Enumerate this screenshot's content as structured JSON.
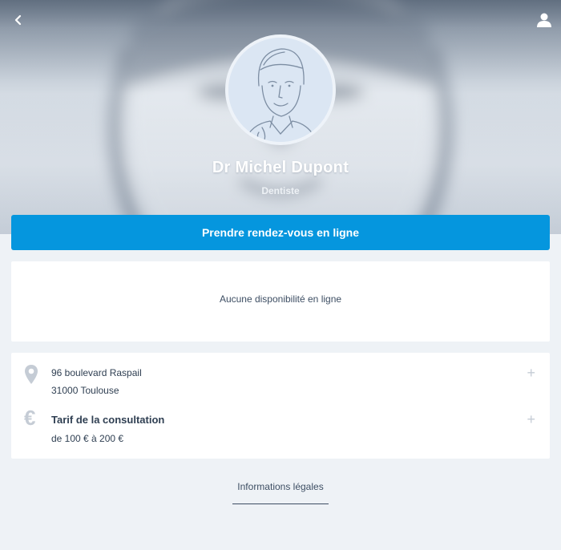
{
  "header": {
    "back_icon": "chevron-left-icon",
    "account_icon": "user-icon"
  },
  "profile": {
    "name": "Dr Michel Dupont",
    "specialty": "Dentiste",
    "avatar_icon": "doctor-portrait-icon"
  },
  "booking": {
    "button_label": "Prendre rendez-vous en ligne",
    "accent_color": "#0596de"
  },
  "availability": {
    "message": "Aucune disponibilité en ligne"
  },
  "info": {
    "address": {
      "icon": "map-pin-icon",
      "line1": "96 boulevard Raspail",
      "line2": "31000 Toulouse"
    },
    "fee": {
      "icon": "euro-icon",
      "title": "Tarif de la consultation",
      "range": "de 100 € à 200 €"
    },
    "expand_icon": "plus-icon"
  },
  "footer": {
    "legal_link": "Informations légales"
  }
}
